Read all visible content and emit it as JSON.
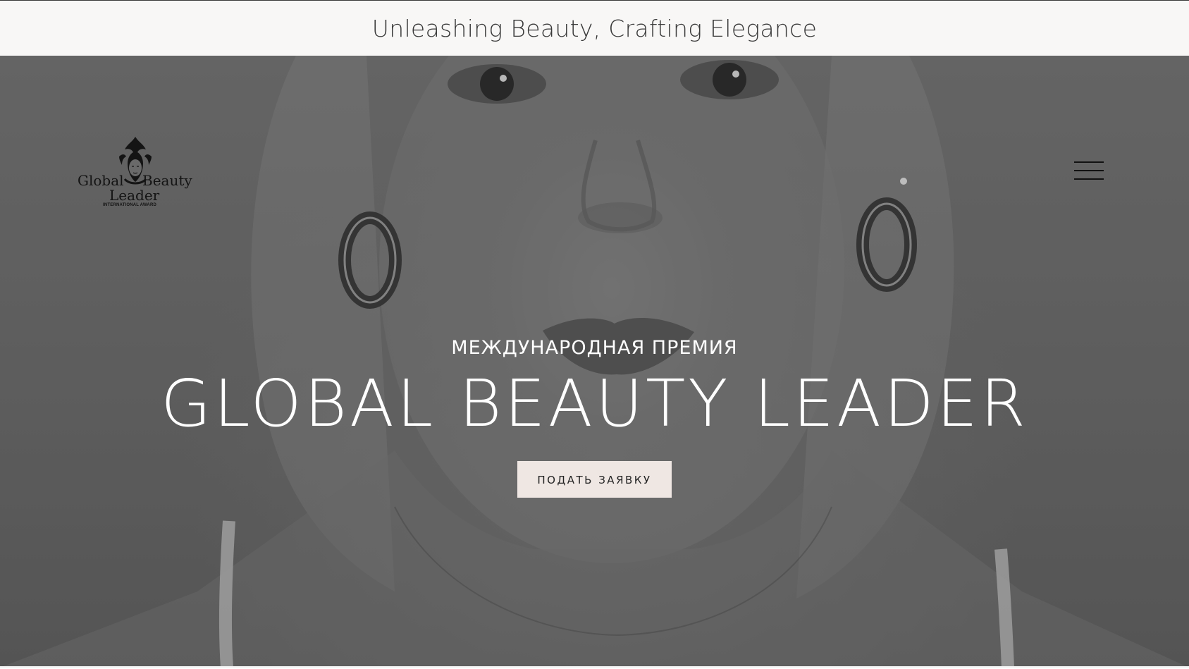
{
  "banner": {
    "tagline": "Unleashing Beauty, Crafting Elegance"
  },
  "header": {
    "logo": {
      "word1": "Global",
      "word2": "Beauty",
      "word3": "Leader",
      "subtitle": "INTERNATIONAL AWARD"
    },
    "menu_icon": "hamburger-menu-icon"
  },
  "hero": {
    "subtitle": "МЕЖДУНАРОДНАЯ ПРЕМИЯ",
    "title": "GLOBAL BEAUTY LEADER",
    "cta_label": "ПОДАТЬ ЗАЯВКУ",
    "background_image": "black-and-white portrait photo"
  },
  "colors": {
    "banner_bg": "#f8f7f6",
    "banner_text": "#3a3a3a",
    "hero_overlay": "#646464",
    "title_text": "#ffffff",
    "cta_bg": "#efe7e3",
    "cta_text": "#222222"
  }
}
